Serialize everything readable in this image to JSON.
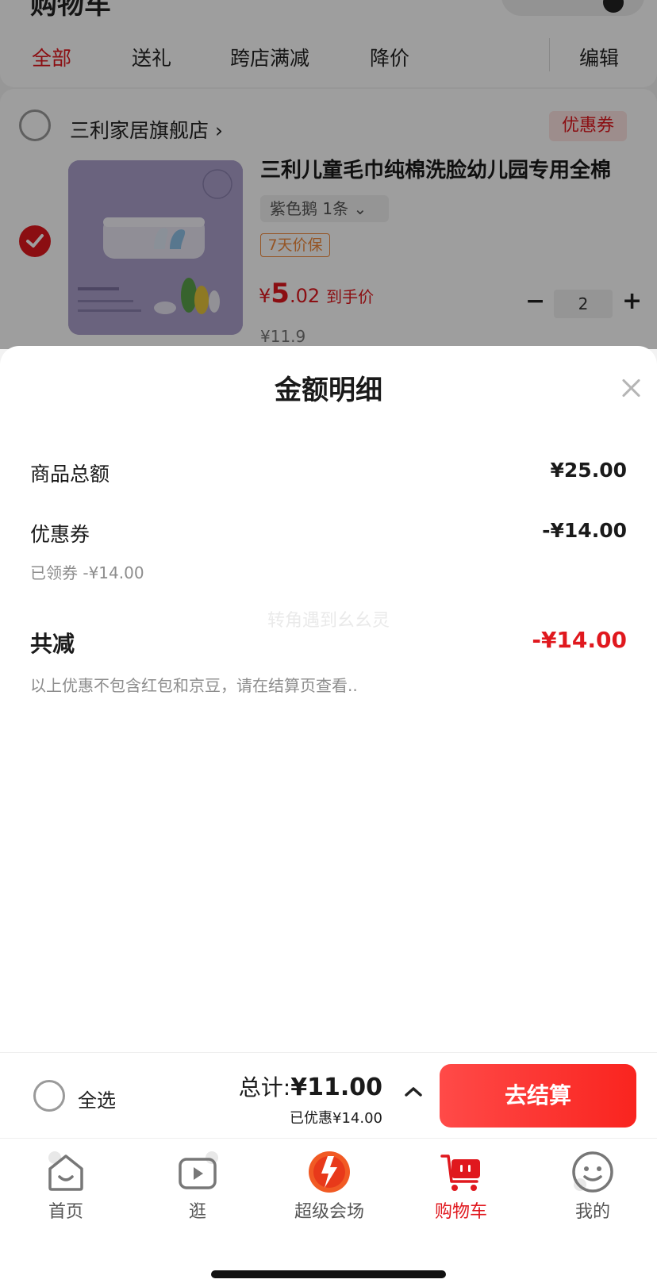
{
  "cart": {
    "page_title": "购物车",
    "tabs": [
      "全部",
      "送礼",
      "跨店满减",
      "降价",
      "编辑"
    ],
    "store": {
      "name": "三利家居旗舰店 ›",
      "coupon_tag": "优惠券"
    },
    "product": {
      "title": "三利儿童毛巾纯棉洗脸幼儿园专用全棉",
      "variant": "紫色鹅 1条 ⌄",
      "guarantee": "7天价保",
      "price_yen": "¥",
      "price_int": "5",
      "price_dec": ".02",
      "price_note": "到手价",
      "original_price": "¥11.9",
      "quantity": "2",
      "minus": "−",
      "plus": "+"
    }
  },
  "sheet": {
    "title": "金额明细",
    "goods_total_label": "商品总额",
    "goods_total_value": "¥25.00",
    "coupon_label": "优惠券",
    "coupon_value": "-¥14.00",
    "coupon_sub": "已领券 -¥14.00",
    "watermark": "转角遇到幺幺灵",
    "total_discount_label": "共减",
    "total_discount_value": "-¥14.00",
    "disclaimer": "以上优惠不包含红包和京豆，请在结算页查看.."
  },
  "checkout": {
    "select_all": "全选",
    "total_label": "总计:",
    "total_value": "¥11.00",
    "saved": "已优惠¥14.00",
    "button": "去结算"
  },
  "tabbar": {
    "items": [
      {
        "label": "首页",
        "icon": "home-icon"
      },
      {
        "label": "逛",
        "icon": "play-icon"
      },
      {
        "label": "超级会场",
        "icon": "super-venue-icon"
      },
      {
        "label": "购物车",
        "icon": "cart-icon"
      },
      {
        "label": "我的",
        "icon": "smile-icon"
      }
    ]
  },
  "colors": {
    "accent": "#e0181e",
    "checkout_gradient_start": "#ff4a48",
    "checkout_gradient_end": "#f9241f",
    "muted_text": "#8d8d8d"
  }
}
